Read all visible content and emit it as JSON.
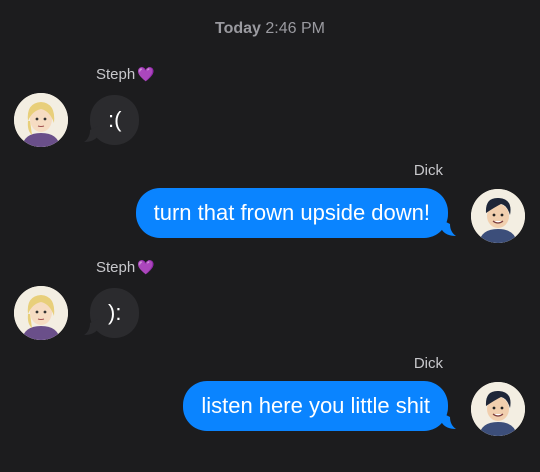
{
  "header": {
    "day": "Today",
    "time": "2:46 PM"
  },
  "messages": [
    {
      "sender": "Steph",
      "sender_badge": "💜",
      "text": ":(",
      "direction": "incoming"
    },
    {
      "sender": "Dick",
      "text": "turn that frown upside down!",
      "direction": "outgoing"
    },
    {
      "sender": "Steph",
      "sender_badge": "💜",
      "text": "):",
      "direction": "incoming"
    },
    {
      "sender": "Dick",
      "text": "listen here you little shit",
      "direction": "outgoing"
    }
  ],
  "colors": {
    "background": "#1c1c1e",
    "incoming_bubble": "#2b2b2e",
    "outgoing_bubble": "#0a84ff",
    "heart": "#a64ce6"
  },
  "icons": {
    "steph_avatar": "steph-avatar-icon",
    "dick_avatar": "dick-avatar-icon",
    "heart": "purple-heart-icon"
  }
}
